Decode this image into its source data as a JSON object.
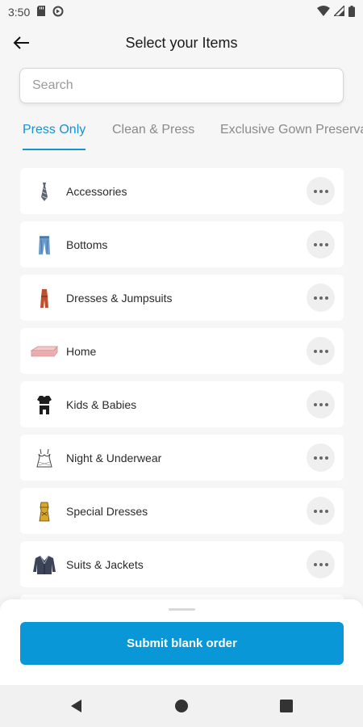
{
  "status_bar": {
    "time": "3:50",
    "icons": [
      "sd-card-icon",
      "data-saver-icon",
      "wifi-icon",
      "signal-icon",
      "battery-icon"
    ]
  },
  "header": {
    "back_icon": "arrow-left-icon",
    "title": "Select your Items"
  },
  "search": {
    "placeholder": "Search",
    "value": ""
  },
  "tabs": [
    {
      "label": "Press Only",
      "active": true
    },
    {
      "label": "Clean & Press",
      "active": false
    },
    {
      "label": "Exclusive Gown Preservation",
      "active": false
    }
  ],
  "categories": [
    {
      "label": "Accessories",
      "icon": "tie-icon"
    },
    {
      "label": "Bottoms",
      "icon": "jeans-icon"
    },
    {
      "label": "Dresses & Jumpsuits",
      "icon": "jumpsuit-icon"
    },
    {
      "label": "Home",
      "icon": "folded-linen-icon"
    },
    {
      "label": "Kids & Babies",
      "icon": "baby-clothes-icon"
    },
    {
      "label": "Night & Underwear",
      "icon": "lingerie-icon"
    },
    {
      "label": "Special Dresses",
      "icon": "special-dress-icon"
    },
    {
      "label": "Suits & Jackets",
      "icon": "jacket-icon"
    }
  ],
  "more_icon": "more-horizontal-icon",
  "bottom_sheet": {
    "submit_label": "Submit blank order"
  },
  "nav_bar": {
    "icons": [
      "back-triangle-icon",
      "home-circle-icon",
      "recents-square-icon"
    ]
  },
  "colors": {
    "accent": "#1592d3",
    "button": "#0a97d8",
    "background": "#f6f6f7",
    "card": "#ffffff"
  }
}
